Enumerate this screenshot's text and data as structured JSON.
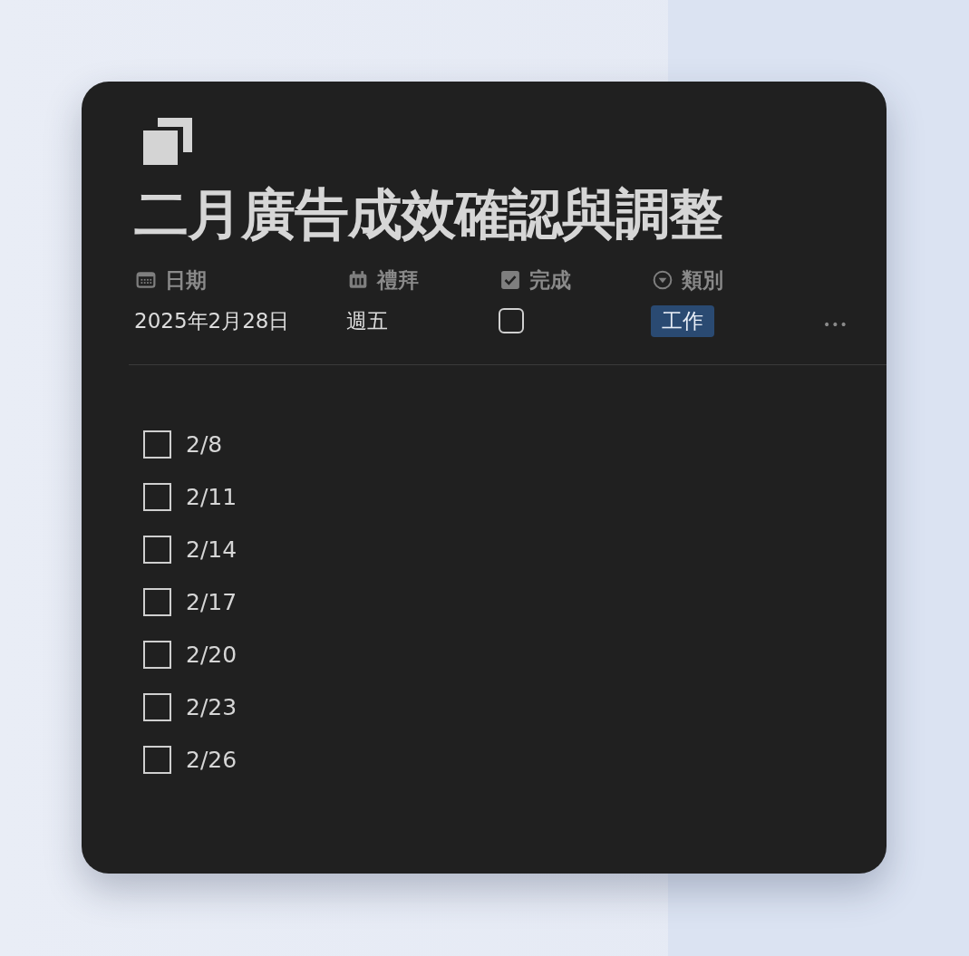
{
  "page": {
    "title": "二月廣告成效確認與調整"
  },
  "properties": [
    {
      "kind": "date",
      "label": "日期",
      "value": "2025年2月28日"
    },
    {
      "kind": "text",
      "label": "禮拜",
      "value": "週五"
    },
    {
      "kind": "checkbox",
      "label": "完成",
      "checked": false
    },
    {
      "kind": "select",
      "label": "類別",
      "value": "工作"
    }
  ],
  "more_button": "•••",
  "todos": [
    {
      "text": "2/8",
      "checked": false
    },
    {
      "text": "2/11",
      "checked": false
    },
    {
      "text": "2/14",
      "checked": false
    },
    {
      "text": "2/17",
      "checked": false
    },
    {
      "text": "2/20",
      "checked": false
    },
    {
      "text": "2/23",
      "checked": false
    },
    {
      "text": "2/26",
      "checked": false
    }
  ]
}
